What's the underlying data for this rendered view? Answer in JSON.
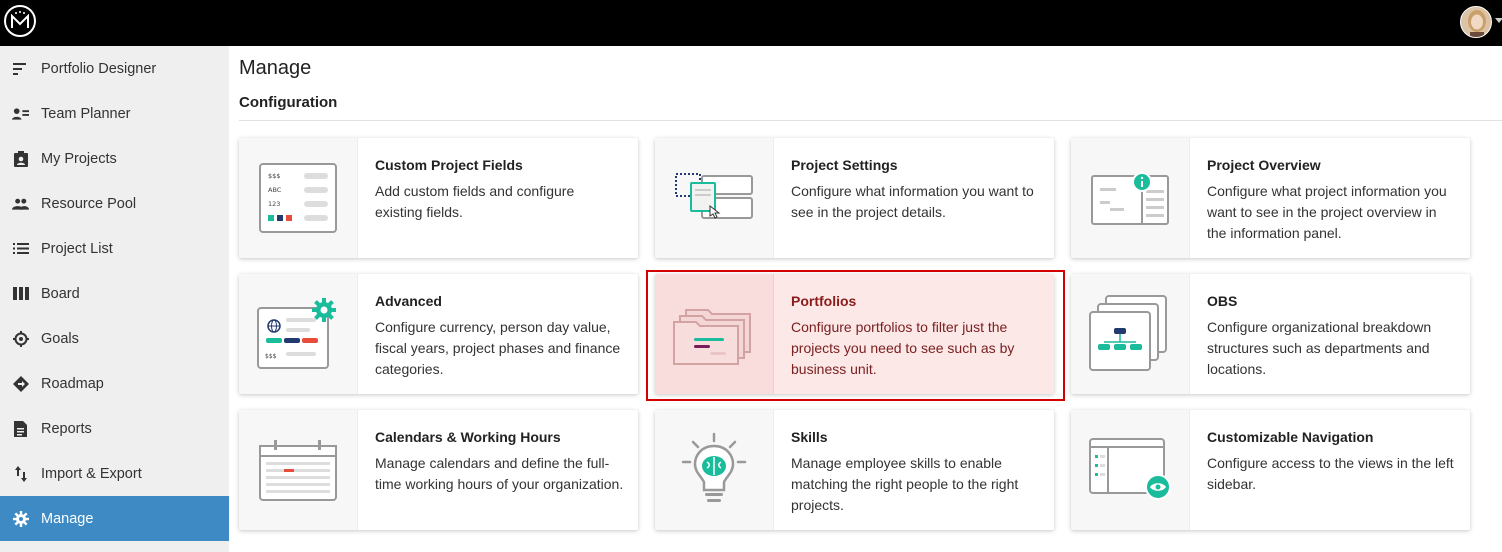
{
  "app": {
    "logo_text": "M",
    "accent_color": "#3d8ac4",
    "highlight_color": "#d40000",
    "teal_color": "#1abc9c"
  },
  "sidebar": {
    "items": [
      {
        "label": "Portfolio Designer",
        "icon": "portfolio-designer-icon"
      },
      {
        "label": "Team Planner",
        "icon": "team-planner-icon"
      },
      {
        "label": "My Projects",
        "icon": "my-projects-icon"
      },
      {
        "label": "Resource Pool",
        "icon": "resource-pool-icon"
      },
      {
        "label": "Project List",
        "icon": "project-list-icon"
      },
      {
        "label": "Board",
        "icon": "board-icon"
      },
      {
        "label": "Goals",
        "icon": "goals-icon"
      },
      {
        "label": "Roadmap",
        "icon": "roadmap-icon"
      },
      {
        "label": "Reports",
        "icon": "reports-icon"
      },
      {
        "label": "Import & Export",
        "icon": "import-export-icon"
      },
      {
        "label": "Manage",
        "icon": "gear-icon",
        "active": true
      }
    ]
  },
  "main": {
    "title": "Manage",
    "section": "Configuration",
    "cards": [
      {
        "title": "Custom Project Fields",
        "desc": "Add custom fields and configure existing fields.",
        "icon": "custom-fields-illustration",
        "img_text": [
          "$$$",
          "ABC",
          "123"
        ]
      },
      {
        "title": "Project Settings",
        "desc": "Configure what information you want to see in the project details.",
        "icon": "project-settings-illustration"
      },
      {
        "title": "Project Overview",
        "desc": "Configure what project information you want to see in the project overview in the information panel.",
        "icon": "project-overview-illustration"
      },
      {
        "title": "Advanced",
        "desc": "Configure currency, person day value, fiscal years, project phases and finance categories.",
        "icon": "advanced-illustration",
        "img_text": [
          "$$$"
        ]
      },
      {
        "title": "Portfolios",
        "desc": "Configure portfolios to filter just the projects you need to see such as by business unit.",
        "icon": "portfolios-illustration",
        "selected": true
      },
      {
        "title": "OBS",
        "desc": "Configure organizational breakdown structures such as departments and locations.",
        "icon": "obs-illustration"
      },
      {
        "title": "Calendars & Working Hours",
        "desc": "Manage calendars and define the full-time working hours of your organization.",
        "icon": "calendar-illustration"
      },
      {
        "title": "Skills",
        "desc": "Manage employee skills to enable matching the right people to the right projects.",
        "icon": "skills-illustration"
      },
      {
        "title": "Customizable Navigation",
        "desc": "Configure access to the views in the left sidebar.",
        "icon": "navigation-illustration"
      }
    ]
  }
}
